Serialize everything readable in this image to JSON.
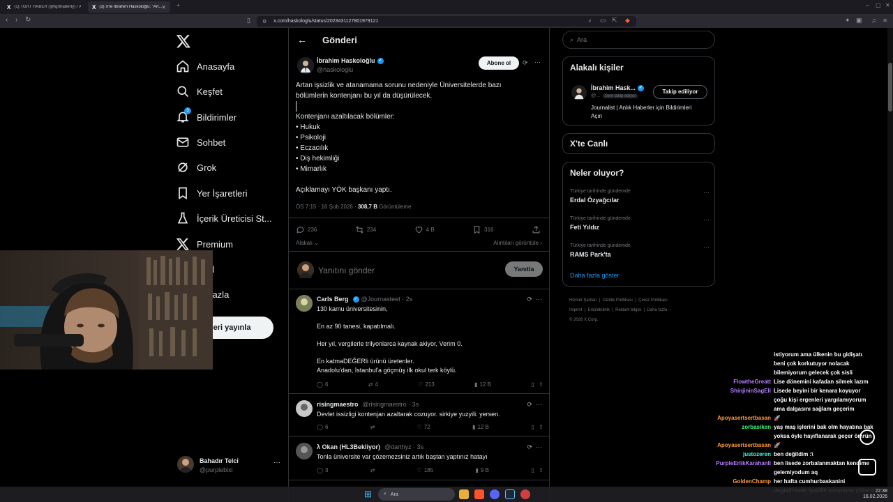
{
  "browser": {
    "tabs": [
      {
        "favicon": "X",
        "title": "(1) TGRT HABER (@tgrthaberty) / X"
      },
      {
        "favicon": "X",
        "title": "(3) X'te İbrahim Haskoloğlu: \"Art..."
      }
    ],
    "new_tab": "+",
    "url": "x.com/haskologlu/status/2023431127801979121",
    "window_controls": [
      "–",
      "▢",
      "✕"
    ]
  },
  "nav": {
    "items": [
      {
        "label": "Anasayfa",
        "icon": "home-icon"
      },
      {
        "label": "Keşfet",
        "icon": "search-icon"
      },
      {
        "label": "Bildirimler",
        "icon": "bell-icon",
        "badge": "3"
      },
      {
        "label": "Sohbet",
        "icon": "mail-icon"
      },
      {
        "label": "Grok",
        "icon": "grok-icon"
      },
      {
        "label": "Yer İşaretleri",
        "icon": "bookmark-icon"
      },
      {
        "label": "İçerik Üreticisi St...",
        "icon": "creator-icon"
      },
      {
        "label": "Premium",
        "icon": "x-logo-icon"
      },
      {
        "label": "fil",
        "icon": "profile-icon"
      },
      {
        "label": "a fazla",
        "icon": "more-icon"
      }
    ],
    "post_button": "leri yayınla",
    "account": {
      "name": "Bahadır Telci",
      "handle": "@purplebixi",
      "more": "···"
    }
  },
  "main": {
    "title": "Gönderi",
    "post": {
      "author": "İbrahim Haskoloğlu",
      "handle": "@haskologlu",
      "subscribe": "Abone ol",
      "lines": [
        "Artan işsizlik ve atanamama sorunu nedeniyle Üniversitelerde bazı",
        "bölümlerin kontenjanı bu yıl da düşürülecek.",
        "",
        "Kontenjanı azaltılacak bölümler:",
        "• Hukuk",
        "• Psikoloji",
        "• Eczacılık",
        "• Diş hekimliği",
        "• Mimarlık",
        "",
        "Açıklamayı YÖK başkanı yaptı."
      ],
      "time": "ÖS 7:15 · 16 Şub 2026 · ",
      "views": "308,7 B",
      "views_label": " Görüntüleme",
      "stats": {
        "replies": "236",
        "reposts": "234",
        "likes": "4 B",
        "bookmarks": "316"
      },
      "relevance": "Alakalı",
      "quotes_link": "Alıntıları görüntüle"
    },
    "reply_placeholder": "Yanıtını gönder",
    "reply_button": "Yanıtla",
    "replies": [
      {
        "name": "Carls Berg",
        "handle": "@Journasteet · 2s",
        "text": "130 kamu üniversitesinin,\n\nEn az 90 tanesi, kapatılmalı.\n\nHer yıl, vergilerle trilyonlarca kaynak akiyor, Verim 0.\n\nEn katmaDEĞERli ürünü üretenler.\nAnadolu'dan, İstanbul'a göçmüş ilk okul terk köylü.",
        "stats": [
          "6",
          "4",
          "213",
          "12 B"
        ]
      },
      {
        "name": "risingmaestro",
        "handle": "@risingmaestro · 3s",
        "text": "Devlet issizligi kontenjan azaltarak cozuyor. sirkiye yuzyili. yersen.",
        "stats": [
          "6",
          "",
          "72",
          "12 B"
        ]
      },
      {
        "name": "λ Okan (HL3Bekliyor)",
        "handle": "@darthyz · 3s",
        "text": "Tonla üniversite var çözemezsiniz artık baştan yaptınız hatayı",
        "stats": [
          "3",
          "",
          "185",
          "9 B"
        ]
      }
    ]
  },
  "right": {
    "search_placeholder": "Ara",
    "related_title": "Alakalı kişiler",
    "related": {
      "name": "İbrahim Hask...",
      "handle": "@...",
      "follows_you": "Seni takip ediyor",
      "bio": "Journalist | Anlık Haberler için Bildirimleri Açın",
      "button": "Takip ediliyor"
    },
    "live_title": "X'te Canlı",
    "trends_title": "Neler oluyor?",
    "trends": [
      {
        "category": "Türkiye tarihinde gündemde",
        "name": "Erdal Özyağcılar"
      },
      {
        "category": "Türkiye tarihinde gündemde",
        "name": "Feti Yıldız"
      },
      {
        "category": "Türkiye tarihinde gündemde",
        "name": "RAMS Park'ta"
      }
    ],
    "show_more": "Daha fazla göster",
    "footer": [
      "Hizmet Şartları",
      "Gizlilik Politikası",
      "Çerez Politikası",
      "Imprint",
      "Erişilebilirlik",
      "Reklam bilgisi",
      "Daha fazla ···",
      "© 2026 X Corp."
    ]
  },
  "chat": [
    {
      "user": "",
      "color": "#ffffff",
      "msg": "istiyorum ama ülkenin bu gidişatı"
    },
    {
      "user": "",
      "color": "#ffffff",
      "msg": "beni çok korkutuyor nolacak"
    },
    {
      "user": "",
      "color": "#ffffff",
      "msg": "bilemiyorum gelecek çok sisli"
    },
    {
      "user": "FlowtheGreatt",
      "color": "#b67cff",
      "msg": "Lise dönemini kafadan silmek lazım"
    },
    {
      "user": "ShinjininSagEli",
      "color": "#b67cff",
      "msg": "Lisede beyini bir kenara koyuyor"
    },
    {
      "user": "",
      "color": "#ffffff",
      "msg": "çoğu kişi ergenleri yargılamıyorum"
    },
    {
      "user": "",
      "color": "#ffffff",
      "msg": "ama dalgasını sağlam geçerim"
    },
    {
      "user": "Apoyasertsertbasan",
      "color": "#ff9a3c",
      "msg": "🚀"
    },
    {
      "user": "zorbasiken",
      "color": "#3cff7a",
      "msg": "yaş maş işlerini bak olm hayatına bak"
    },
    {
      "user": "",
      "color": "#ffffff",
      "msg": "yoksa öyle hayıflanarak geçer ömrün"
    },
    {
      "user": "Apoyasertsertbasan",
      "color": "#ff9a3c",
      "msg": "🚀"
    },
    {
      "user": "justozeren",
      "color": "#3cffd8",
      "msg": "ben değildim :\\"
    },
    {
      "user": "PurpleErlikKarahanli",
      "color": "#b67cff",
      "msg": "ben lisede zorbalanmaktan kendime"
    },
    {
      "user": "",
      "color": "#ffffff",
      "msg": "gelemiyodum aq"
    },
    {
      "user": "GoldenChamp",
      "color": "#ff9a3c",
      "msg": "her hafta cumhurbaskanini"
    },
    {
      "user": "",
      "color": "#ffffff",
      "msg": "degistirirsek işsizlik sorununu çözeriz"
    }
  ],
  "taskbar": {
    "search": "Ara",
    "time": "22:38",
    "date": "16.02.2026"
  }
}
